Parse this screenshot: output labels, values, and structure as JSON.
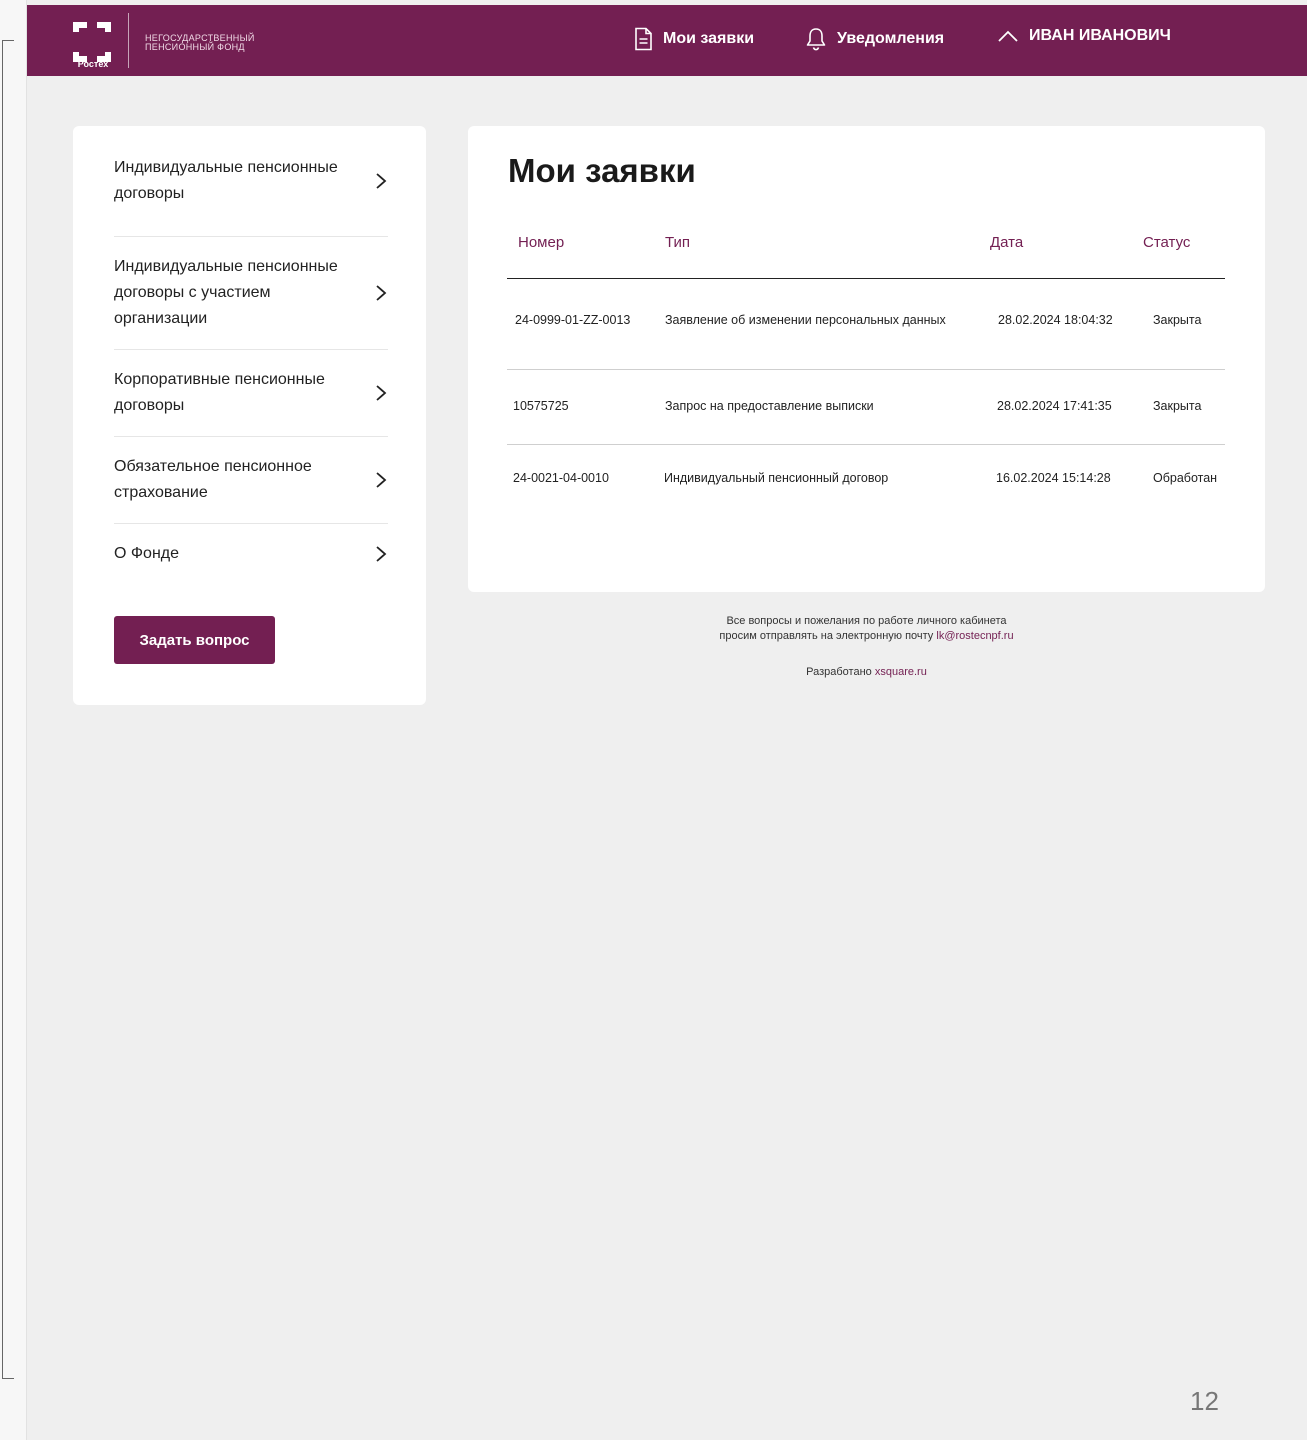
{
  "header": {
    "logo_caption": "Ростех",
    "fund_name_line1": "НЕГОСУДАРСТВЕННЫЙ",
    "fund_name_line2": "ПЕНСИОННЫЙ ФОНД",
    "nav": {
      "requests": "Мои заявки",
      "notifications": "Уведомления",
      "user": "ИВАН ИВАНОВИЧ"
    },
    "brand_color": "#731f52"
  },
  "sidebar": {
    "items": [
      {
        "label": "Индивидуальные пенсионные договоры"
      },
      {
        "label": "Индивидуальные пенсионные договоры с участием организации"
      },
      {
        "label": "Корпоративные пенсионные договоры"
      },
      {
        "label": "Обязательное пенсионное страхование"
      },
      {
        "label": "О Фонде"
      }
    ],
    "ask_button": "Задать вопрос"
  },
  "main": {
    "title": "Мои заявки",
    "columns": [
      "Номер",
      "Тип",
      "Дата",
      "Статус"
    ],
    "rows": [
      {
        "number": "24-0999-01-ZZ-0013",
        "type": "Заявление об изменении персональных данных",
        "date": "28.02.2024 18:04:32",
        "status": "Закрыта"
      },
      {
        "number": "10575725",
        "type": "Запрос на предоставление выписки",
        "date": "28.02.2024 17:41:35",
        "status": "Закрыта"
      },
      {
        "number": "24-0021-04-0010",
        "type": "Индивидуальный пенсионный договор",
        "date": "16.02.2024 15:14:28",
        "status": "Обработан"
      }
    ]
  },
  "footer": {
    "line1": "Все вопросы и пожелания по работе личного кабинета",
    "line2_prefix": "просим отправлять на электронную почту",
    "email": "lk@rostecnpf.ru",
    "developed_prefix": "Разработано",
    "developer": "xsquare.ru"
  },
  "page_number": "12"
}
